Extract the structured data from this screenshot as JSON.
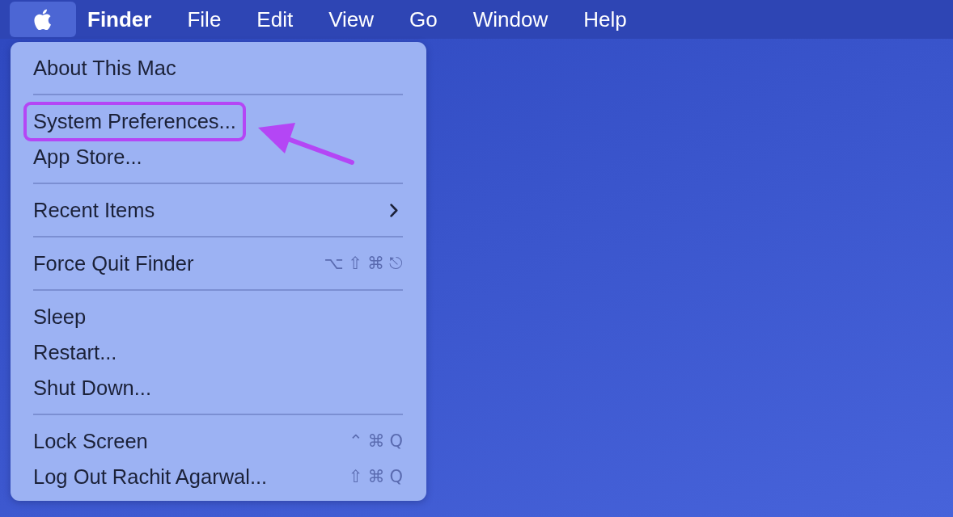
{
  "menu_bar": {
    "apple_menu": {
      "selected": true
    },
    "items": [
      {
        "label": "Finder",
        "kind": "app",
        "selected": false
      },
      {
        "label": "File",
        "kind": "menu",
        "selected": false
      },
      {
        "label": "Edit",
        "kind": "menu",
        "selected": false
      },
      {
        "label": "View",
        "kind": "menu",
        "selected": false
      },
      {
        "label": "Go",
        "kind": "menu",
        "selected": false
      },
      {
        "label": "Window",
        "kind": "menu",
        "selected": false
      },
      {
        "label": "Help",
        "kind": "menu",
        "selected": false
      }
    ]
  },
  "menu": {
    "groups": [
      {
        "items": [
          {
            "label": "About This Mac",
            "submenu": false,
            "highlighted": false
          }
        ]
      },
      {
        "items": [
          {
            "label": "System Preferences...",
            "submenu": false,
            "highlighted": true
          },
          {
            "label": "App Store...",
            "submenu": false,
            "highlighted": false
          }
        ]
      },
      {
        "items": [
          {
            "label": "Recent Items",
            "submenu": true,
            "highlighted": false
          }
        ]
      },
      {
        "items": [
          {
            "label": "Force Quit Finder",
            "shortcut": "⌥⇧⌘⎋",
            "submenu": false,
            "highlighted": false
          }
        ]
      },
      {
        "items": [
          {
            "label": "Sleep",
            "submenu": false,
            "highlighted": false
          },
          {
            "label": "Restart...",
            "submenu": false,
            "highlighted": false
          },
          {
            "label": "Shut Down...",
            "submenu": false,
            "highlighted": false
          }
        ]
      },
      {
        "items": [
          {
            "label": "Lock Screen",
            "shortcut": "⌃⌘Q",
            "submenu": false,
            "highlighted": false
          },
          {
            "label": "Log Out Rachit Agarwal...",
            "shortcut": "⇧⌘Q",
            "submenu": false,
            "highlighted": false
          }
        ]
      }
    ]
  }
}
